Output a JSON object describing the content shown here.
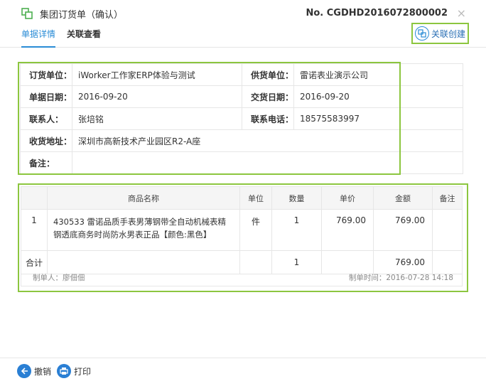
{
  "header": {
    "title": "集团订货单（确认）",
    "doc_no": "No. CGDHD2016072800002",
    "close_glyph": "×"
  },
  "tabs": [
    {
      "label": "单据详情"
    },
    {
      "label": "关联查看"
    }
  ],
  "link_create_label": "关联创建",
  "info": {
    "order_unit_label": "订货单位：",
    "order_unit": "iWorker工作家ERP体验与测试",
    "supplier_label": "供货单位：",
    "supplier": "雷诺表业演示公司",
    "doc_date_label": "单据日期：",
    "doc_date": "2016-09-20",
    "delivery_date_label": "交货日期：",
    "delivery_date": "2016-09-20",
    "contact_label": "联系人：",
    "contact": "张培铭",
    "phone_label": "联系电话：",
    "phone": "18575583997",
    "address_label": "收货地址：",
    "address": "深圳市高新技术产业园区R2-A座",
    "remark_label": "备注：",
    "remark": ""
  },
  "grid": {
    "columns": [
      "",
      "商品名称",
      "单位",
      "数量",
      "单价",
      "金额",
      "备注"
    ],
    "rows": [
      {
        "idx": "1",
        "name": "430533 雷诺品质手表男薄钢带全自动机械表精钢透底商务时尚防水男表正品【颜色:黑色】",
        "unit": "件",
        "qty": "1",
        "price": "769.00",
        "amount": "769.00",
        "remark": ""
      }
    ],
    "total": {
      "label": "合计",
      "qty": "1",
      "amount": "769.00"
    },
    "maker": "制单人：廖佃佃",
    "make_time": "制单时间：2016-07-28 14:18"
  },
  "actions": {
    "undo_label": "撤销",
    "print_label": "打印"
  },
  "colors": {
    "accent": "#2a8cd6",
    "highlight": "#8cc63f"
  }
}
